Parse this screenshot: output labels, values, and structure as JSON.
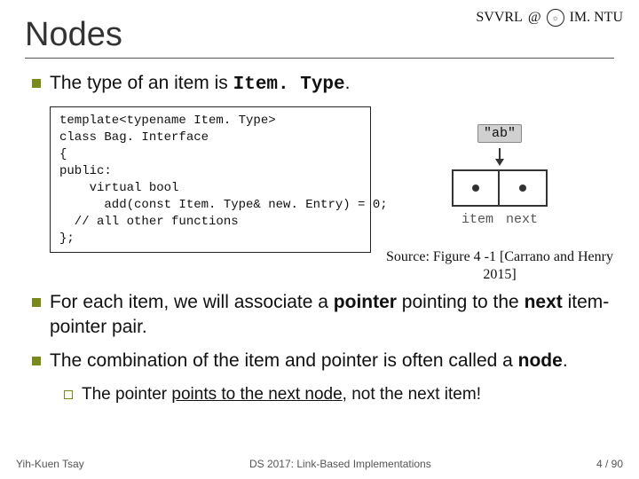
{
  "header": {
    "org_left": "SVVRL",
    "at": "@",
    "org_right": "IM. NTU"
  },
  "title": "Nodes",
  "bullets": {
    "b1_before": "The type of an item is ",
    "b1_code": "Item. Type",
    "b1_after": ".",
    "b2_pre": "For each item, we will associate a ",
    "b2_pointer": "pointer",
    "b2_mid": " pointing to the ",
    "b2_next": "next",
    "b2_post": " item-pointer pair.",
    "b3_pre": "The combination of the item and pointer is often called a ",
    "b3_node": "node",
    "b3_post": ".",
    "sub_pre": "The pointer ",
    "sub_mid": "points to the next node",
    "sub_post": ", not the next item!"
  },
  "code": "template<typename Item. Type>\nclass Bag. Interface\n{\npublic:\n    virtual bool\n      add(const Item. Type& new. Entry) = 0;\n  // all other functions\n};",
  "figure": {
    "ab": "\"ab\"",
    "item": "item",
    "next": "next",
    "caption": "Source: Figure 4 -1 [Carrano and Henry 2015]"
  },
  "footer": {
    "left": "Yih-Kuen Tsay",
    "center": "DS 2017: Link-Based Implementations",
    "right": "4 / 90"
  }
}
